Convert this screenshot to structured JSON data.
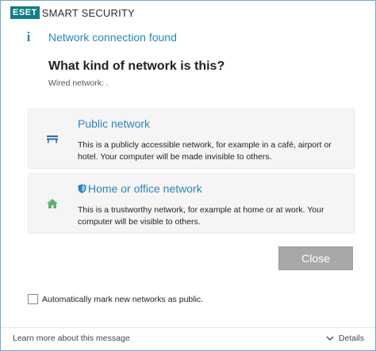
{
  "app": {
    "logo_mark": "ESET",
    "logo_text": "SMART SECURITY"
  },
  "header": {
    "icon": "info-icon",
    "icon_glyph": "i",
    "title": "Network connection found"
  },
  "question": {
    "heading": "What kind of network is this?",
    "subtitle": "Wired network: ."
  },
  "options": [
    {
      "icon": "bench-icon",
      "title": "Public network",
      "description": "This is a publicly accessible network, for example in a café, airport or hotel. Your computer will be made invisible to others."
    },
    {
      "icon": "house-icon",
      "badge_icon": "shield-icon",
      "title": "Home or office network",
      "description": "This is a trustworthy network, for example at home or at work. Your computer will be visible to others."
    }
  ],
  "close_button": "Close",
  "auto_mark": {
    "checked": false,
    "label": "Automatically mark new networks as public."
  },
  "footer": {
    "learn_more": "Learn more about this message",
    "details": "Details"
  },
  "colors": {
    "accent": "#2a86c4",
    "brand": "#0f7f86",
    "home_icon": "#5bb56b",
    "bench_icon": "#2a6fa8",
    "button": "#a8a8a8"
  }
}
